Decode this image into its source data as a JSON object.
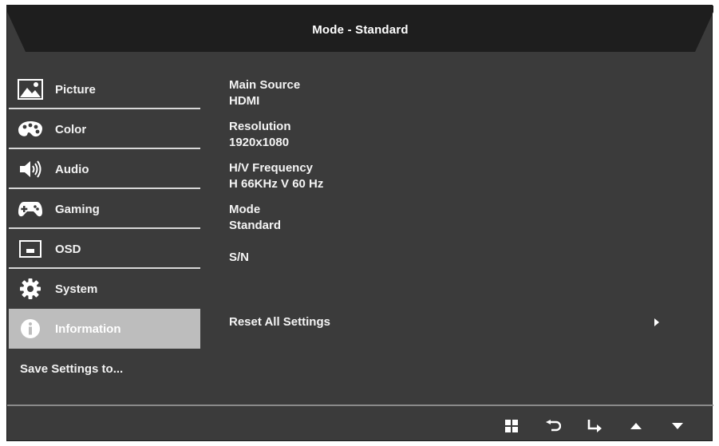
{
  "header": {
    "title": "Mode - Standard"
  },
  "sidebar": {
    "items": [
      {
        "label": "Picture",
        "icon": "picture-icon"
      },
      {
        "label": "Color",
        "icon": "palette-icon"
      },
      {
        "label": "Audio",
        "icon": "speaker-icon"
      },
      {
        "label": "Gaming",
        "icon": "gamepad-icon"
      },
      {
        "label": "OSD",
        "icon": "osd-icon"
      },
      {
        "label": "System",
        "icon": "gear-icon"
      },
      {
        "label": "Information",
        "icon": "info-icon",
        "active": true
      }
    ],
    "save_settings": "Save Settings to..."
  },
  "info": {
    "main_source_label": "Main Source",
    "main_source_value": "HDMI",
    "resolution_label": "Resolution",
    "resolution_value": "1920x1080",
    "frequency_label": "H/V Frequency",
    "frequency_value": "H 66KHz V 60 Hz",
    "mode_label": "Mode",
    "mode_value": "Standard",
    "sn_label": "S/N",
    "reset_label": "Reset All Settings"
  },
  "footer": {
    "icons": [
      "menu-grid-icon",
      "back-icon",
      "enter-icon",
      "up-arrow-icon",
      "down-arrow-icon"
    ]
  },
  "colors": {
    "background": "#3b3b3b",
    "header": "#1e1e1e",
    "active_item": "#bdbdbd"
  }
}
